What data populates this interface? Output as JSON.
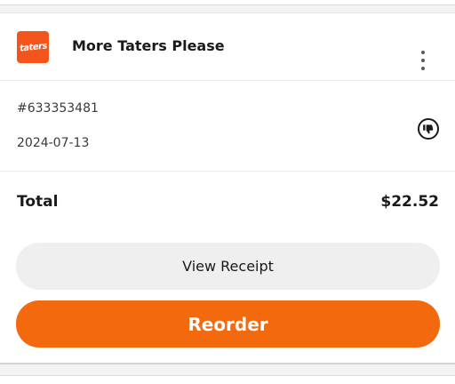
{
  "order": {
    "restaurant_name": "More Taters Please",
    "logo_text": "taters",
    "order_number": "#633353481",
    "date": "2024-07-13",
    "total_label": "Total",
    "total_value": "$22.52"
  },
  "actions": {
    "view_receipt_label": "View Receipt",
    "reorder_label": "Reorder"
  },
  "icons": {
    "menu": "more-vertical-icon",
    "feedback": "thumbs-down-icon"
  },
  "colors": {
    "brand_orange": "#f26a0d",
    "logo_bg": "#f2541b",
    "secondary_button": "#efefef",
    "text": "#1a1a1a"
  }
}
